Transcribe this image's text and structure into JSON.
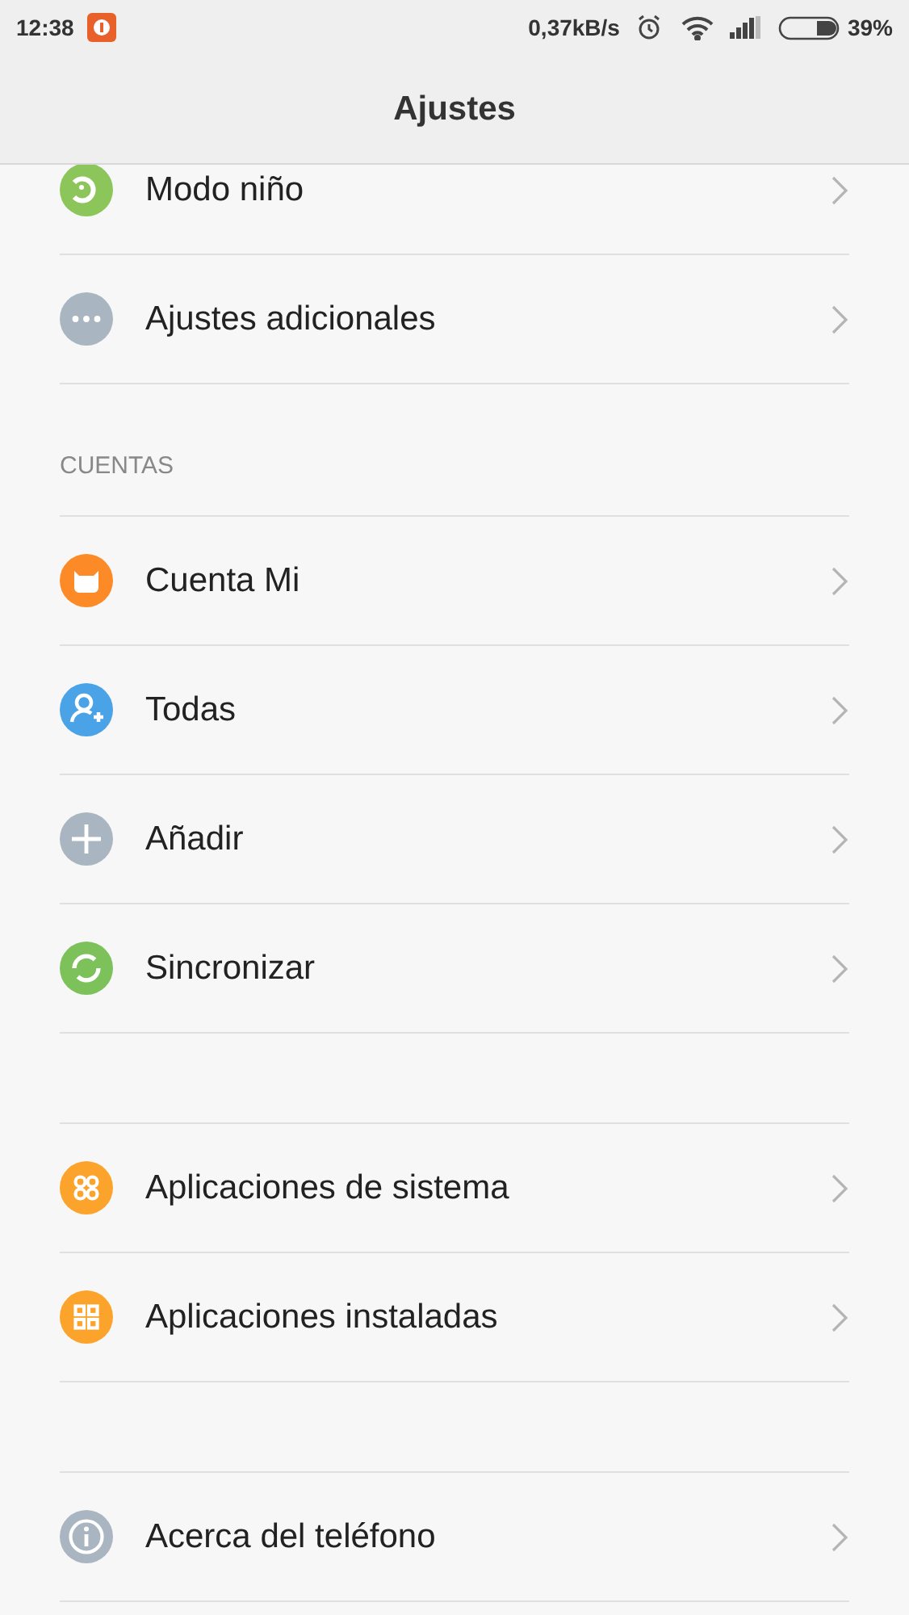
{
  "status_bar": {
    "time": "12:38",
    "speed": "0,37kB/s",
    "battery": "39%"
  },
  "title": "Ajustes",
  "sections": [
    {
      "items": [
        {
          "label": "Modo niño",
          "kind": "kid",
          "color": "#8cc65a"
        },
        {
          "label": "Ajustes adicionales",
          "kind": "more",
          "color": "#a9b5c1"
        }
      ]
    },
    {
      "header": "CUENTAS",
      "items": [
        {
          "label": "Cuenta Mi",
          "kind": "mi",
          "color": "#fb8a27"
        },
        {
          "label": "Todas",
          "kind": "person",
          "color": "#49a3e6"
        },
        {
          "label": "Añadir",
          "kind": "plus",
          "color": "#a9b5c1"
        },
        {
          "label": "Sincronizar",
          "kind": "sync",
          "color": "#7cc15a"
        }
      ]
    },
    {
      "items": [
        {
          "label": "Aplicaciones de sistema",
          "kind": "appsround",
          "color": "#fba32a"
        },
        {
          "label": "Aplicaciones instaladas",
          "kind": "appssquare",
          "color": "#fba32a"
        }
      ]
    },
    {
      "items": [
        {
          "label": "Acerca del teléfono",
          "kind": "info",
          "color": "#a9b5c1"
        }
      ]
    }
  ]
}
